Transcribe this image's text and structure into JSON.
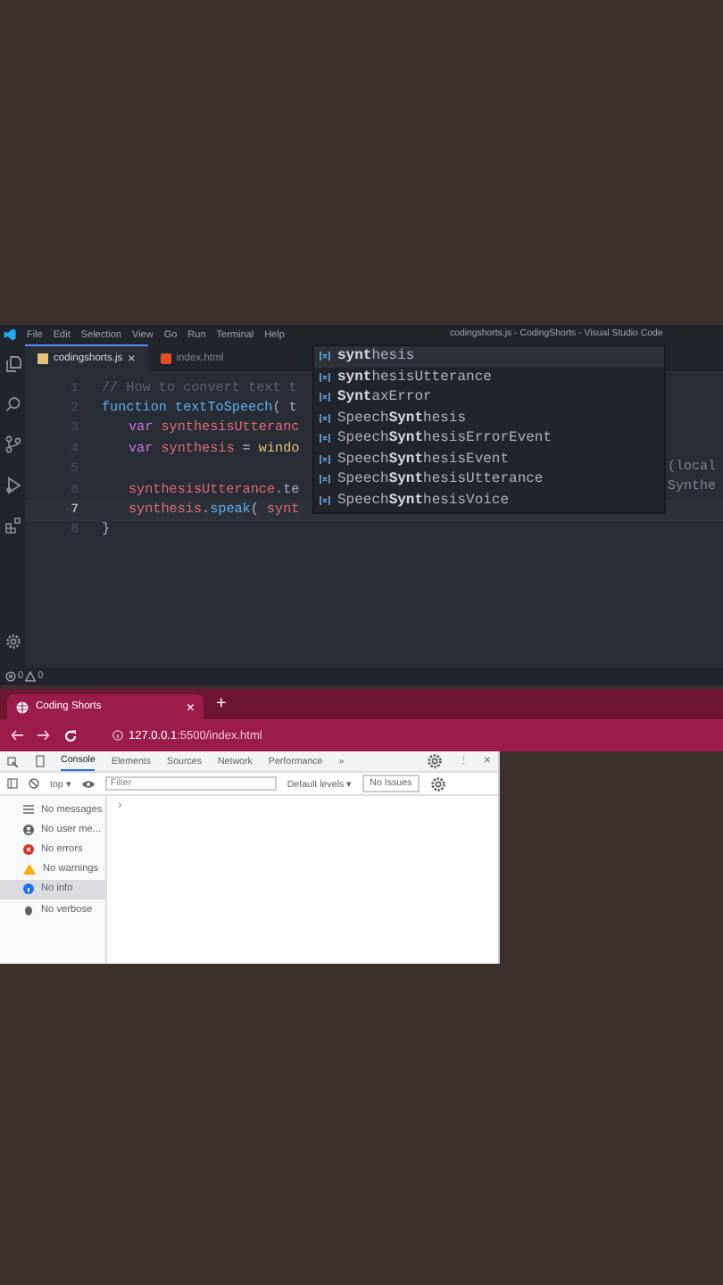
{
  "editor": {
    "title": "codingshorts.js - CodingShorts - Visual Studio Code",
    "menu": [
      "File",
      "Edit",
      "Selection",
      "View",
      "Go",
      "Run",
      "Terminal",
      "Help"
    ],
    "tabs": [
      {
        "label": "codingshorts.js",
        "selected": true,
        "kind": "js",
        "close": "×"
      },
      {
        "label": "index.html",
        "selected": false,
        "kind": "html"
      }
    ],
    "lines": [
      {
        "number": "1",
        "active": false,
        "indented": false,
        "tokens": [
          {
            "text": "// How to convert text t",
            "kind": "comment"
          }
        ]
      },
      {
        "number": "2",
        "active": false,
        "indented": false,
        "tokens": [
          {
            "text": "function ",
            "kind": "keyword"
          },
          {
            "text": "textToSpeech",
            "kind": "function"
          },
          {
            "text": "( t",
            "kind": "plain"
          }
        ]
      },
      {
        "number": "3",
        "active": false,
        "indented": true,
        "tokens": [
          {
            "text": "var ",
            "kind": "storage"
          },
          {
            "text": "synthesisUtteranc",
            "kind": "variable"
          }
        ]
      },
      {
        "number": "4",
        "active": false,
        "indented": true,
        "tokens": [
          {
            "text": "var ",
            "kind": "storage"
          },
          {
            "text": "synthesis",
            "kind": "variable"
          },
          {
            "text": " = ",
            "kind": "plain"
          },
          {
            "text": "windo",
            "kind": "global"
          }
        ]
      },
      {
        "number": "5",
        "active": false
      },
      {
        "number": "6",
        "active": false,
        "indented": true,
        "tokens": [
          {
            "text": "synthesisUtterance",
            "kind": "variable"
          },
          {
            "text": ".te",
            "kind": "plain"
          }
        ]
      },
      {
        "number": "7",
        "active": true,
        "indented": true,
        "tokens": [
          {
            "text": "synthesis",
            "kind": "variable"
          },
          {
            "text": ".",
            "kind": "plain"
          },
          {
            "text": "speak",
            "kind": "function"
          },
          {
            "text": "( ",
            "kind": "plain"
          },
          {
            "text": "synt",
            "kind": "variable"
          }
        ]
      },
      {
        "number": "8",
        "active": false,
        "indented": false,
        "tokens": [
          {
            "text": "}",
            "kind": "plain"
          }
        ]
      }
    ],
    "suggestions": [
      {
        "label": "**synt**hesis",
        "selected": true
      },
      {
        "label": "**synt**hesisUtterance",
        "selected": false
      },
      {
        "label": "**Synt**axError",
        "selected": false
      },
      {
        "label": "Speech**Synt**hesis",
        "selected": false
      },
      {
        "label": "Speech**Synt**hesisErrorEvent",
        "selected": false
      },
      {
        "label": "Speech**Synt**hesisEvent",
        "selected": false
      },
      {
        "label": "Speech**Synt**hesisUtterance",
        "selected": false
      },
      {
        "label": "Speech**Synt**hesisVoice",
        "selected": false
      }
    ],
    "detail": [
      "(local",
      "Synthe"
    ],
    "status": {
      "errors": "0",
      "warnings": "0"
    }
  },
  "browser": {
    "tab": {
      "title": "Coding Shorts",
      "close": "×"
    },
    "new_tab": "+",
    "url": "**127.0.0.1**:5500/index.html",
    "devtools": {
      "tabs": [
        {
          "label": "Console",
          "selected": true
        },
        {
          "label": "Elements",
          "selected": false
        },
        {
          "label": "Sources",
          "selected": false
        },
        {
          "label": "Network",
          "selected": false
        },
        {
          "label": "Performance",
          "selected": false
        }
      ],
      "more": "»",
      "more_menu": "⋮",
      "close": "×",
      "context": "top ▾",
      "filter": {
        "placeholder": "Filter"
      },
      "levels": "Default levels ▾",
      "issues": "No Issues",
      "sidebar": [
        {
          "label": "No messages",
          "kind": "list",
          "selected": false
        },
        {
          "label": "No user me...",
          "kind": "user",
          "selected": false
        },
        {
          "label": "No errors",
          "kind": "error",
          "selected": false
        },
        {
          "label": "No warnings",
          "kind": "warning",
          "selected": false
        },
        {
          "label": "No info",
          "kind": "info",
          "selected": true
        },
        {
          "label": "No verbose",
          "kind": "verbose",
          "selected": false
        }
      ],
      "prompt": "›"
    }
  }
}
